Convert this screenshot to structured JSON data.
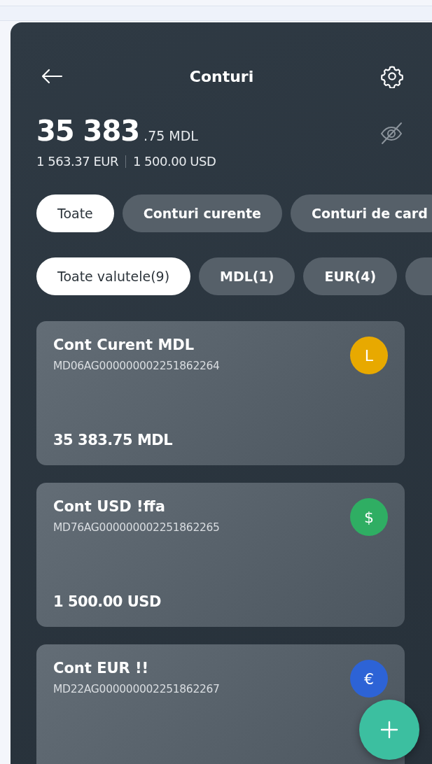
{
  "header": {
    "title": "Conturi"
  },
  "balance": {
    "integer": "35 383",
    "fraction": ".75 MDL",
    "other": [
      "1 563.37 EUR",
      "1 500.00 USD"
    ]
  },
  "type_filters": [
    {
      "label": "Toate",
      "selected": true
    },
    {
      "label": "Conturi curente",
      "selected": false
    },
    {
      "label": "Conturi de card",
      "selected": false
    }
  ],
  "currency_filters": [
    {
      "label": "Toate valutele(9)",
      "selected": true
    },
    {
      "label": "MDL(1)",
      "selected": false
    },
    {
      "label": "EUR(4)",
      "selected": false
    }
  ],
  "accounts": [
    {
      "name": "Cont Curent MDL",
      "iban": "MD06AG000000002251862264",
      "amount": "35 383.75 MDL",
      "symbol": "L",
      "color": "#e8a900"
    },
    {
      "name": "Cont USD !ffa",
      "iban": "MD76AG000000002251862265",
      "amount": "1 500.00 USD",
      "symbol": "$",
      "color": "#2fae63"
    },
    {
      "name": "Cont EUR !!",
      "iban": "MD22AG000000002251862267",
      "symbol": "€",
      "color": "#2d63d6"
    }
  ]
}
